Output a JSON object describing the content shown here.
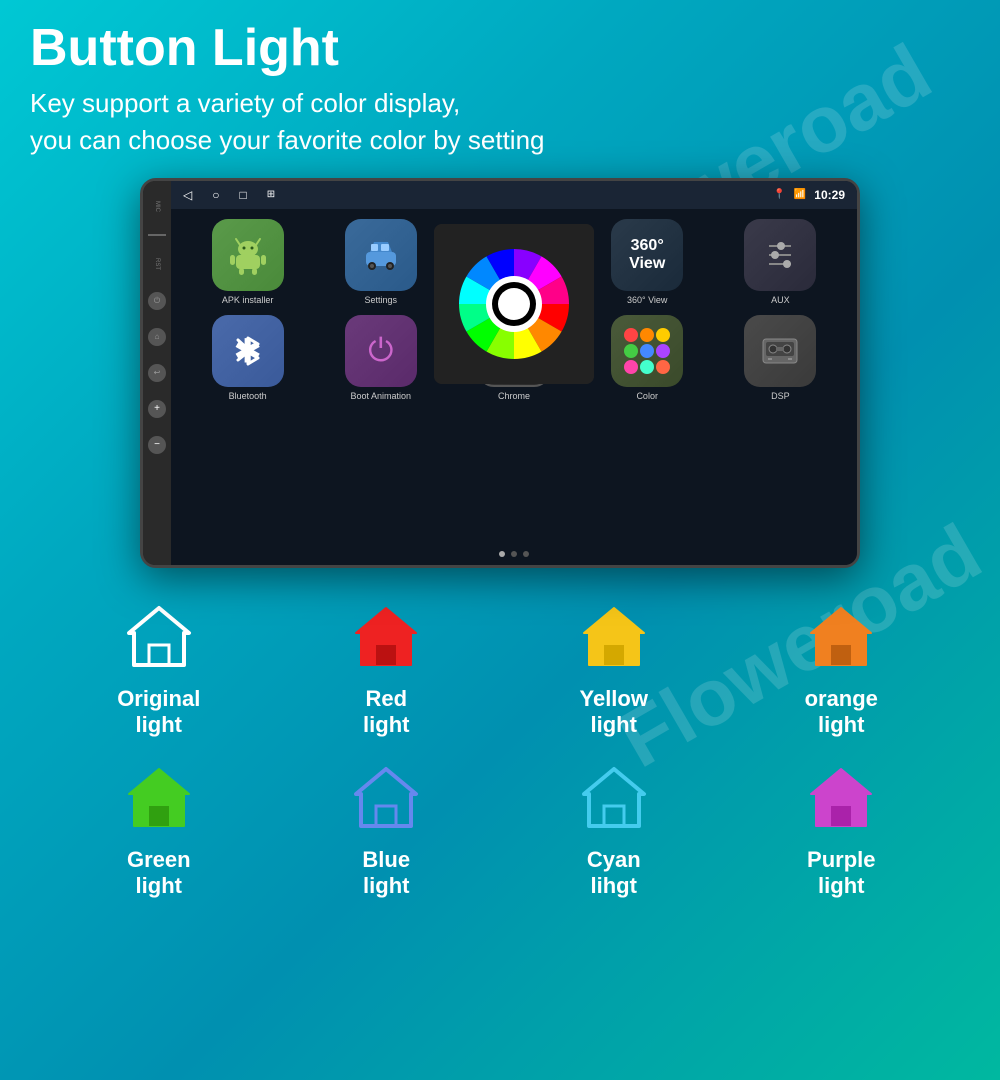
{
  "page": {
    "title": "Button Light",
    "subtitle_line1": "Key support a variety of color display,",
    "subtitle_line2": "you can choose your favorite color by setting"
  },
  "device": {
    "time": "10:29",
    "mic_label": "MIC",
    "rst_label": "RST"
  },
  "nav_icons": [
    "◁",
    "○",
    "□",
    "⊞"
  ],
  "apps": [
    {
      "label": "APK Installer",
      "icon_type": "android"
    },
    {
      "label": "Settings",
      "icon_type": "settings"
    },
    {
      "label": "",
      "icon_type": "color-wheel"
    },
    {
      "label": "360° View",
      "icon_type": "view360"
    },
    {
      "label": "AUX",
      "icon_type": "aux"
    },
    {
      "label": "Bluetooth",
      "icon_type": "bluetooth"
    },
    {
      "label": "Boot Animation",
      "icon_type": "boot"
    },
    {
      "label": "Chrome",
      "icon_type": "chrome"
    },
    {
      "label": "Color",
      "icon_type": "color"
    },
    {
      "label": "DSP",
      "icon_type": "dsp"
    }
  ],
  "lights": [
    {
      "label": "Original\nlight",
      "color": "#ffffff",
      "outline_only": true
    },
    {
      "label": "Red\nlight",
      "color": "#ee2222"
    },
    {
      "label": "Yellow\nlight",
      "color": "#f5c518"
    },
    {
      "label": "orange\nlight",
      "color": "#f08020"
    },
    {
      "label": "Green\nlight",
      "color": "#44cc22"
    },
    {
      "label": "Blue\nlight",
      "color": "#6688ee"
    },
    {
      "label": "Cyan\nlihgt",
      "color": "#44ccee"
    },
    {
      "label": "Purple\nlight",
      "color": "#cc44cc"
    }
  ],
  "watermarks": [
    "Floweroad",
    "Floweroad",
    "Floweroad"
  ]
}
